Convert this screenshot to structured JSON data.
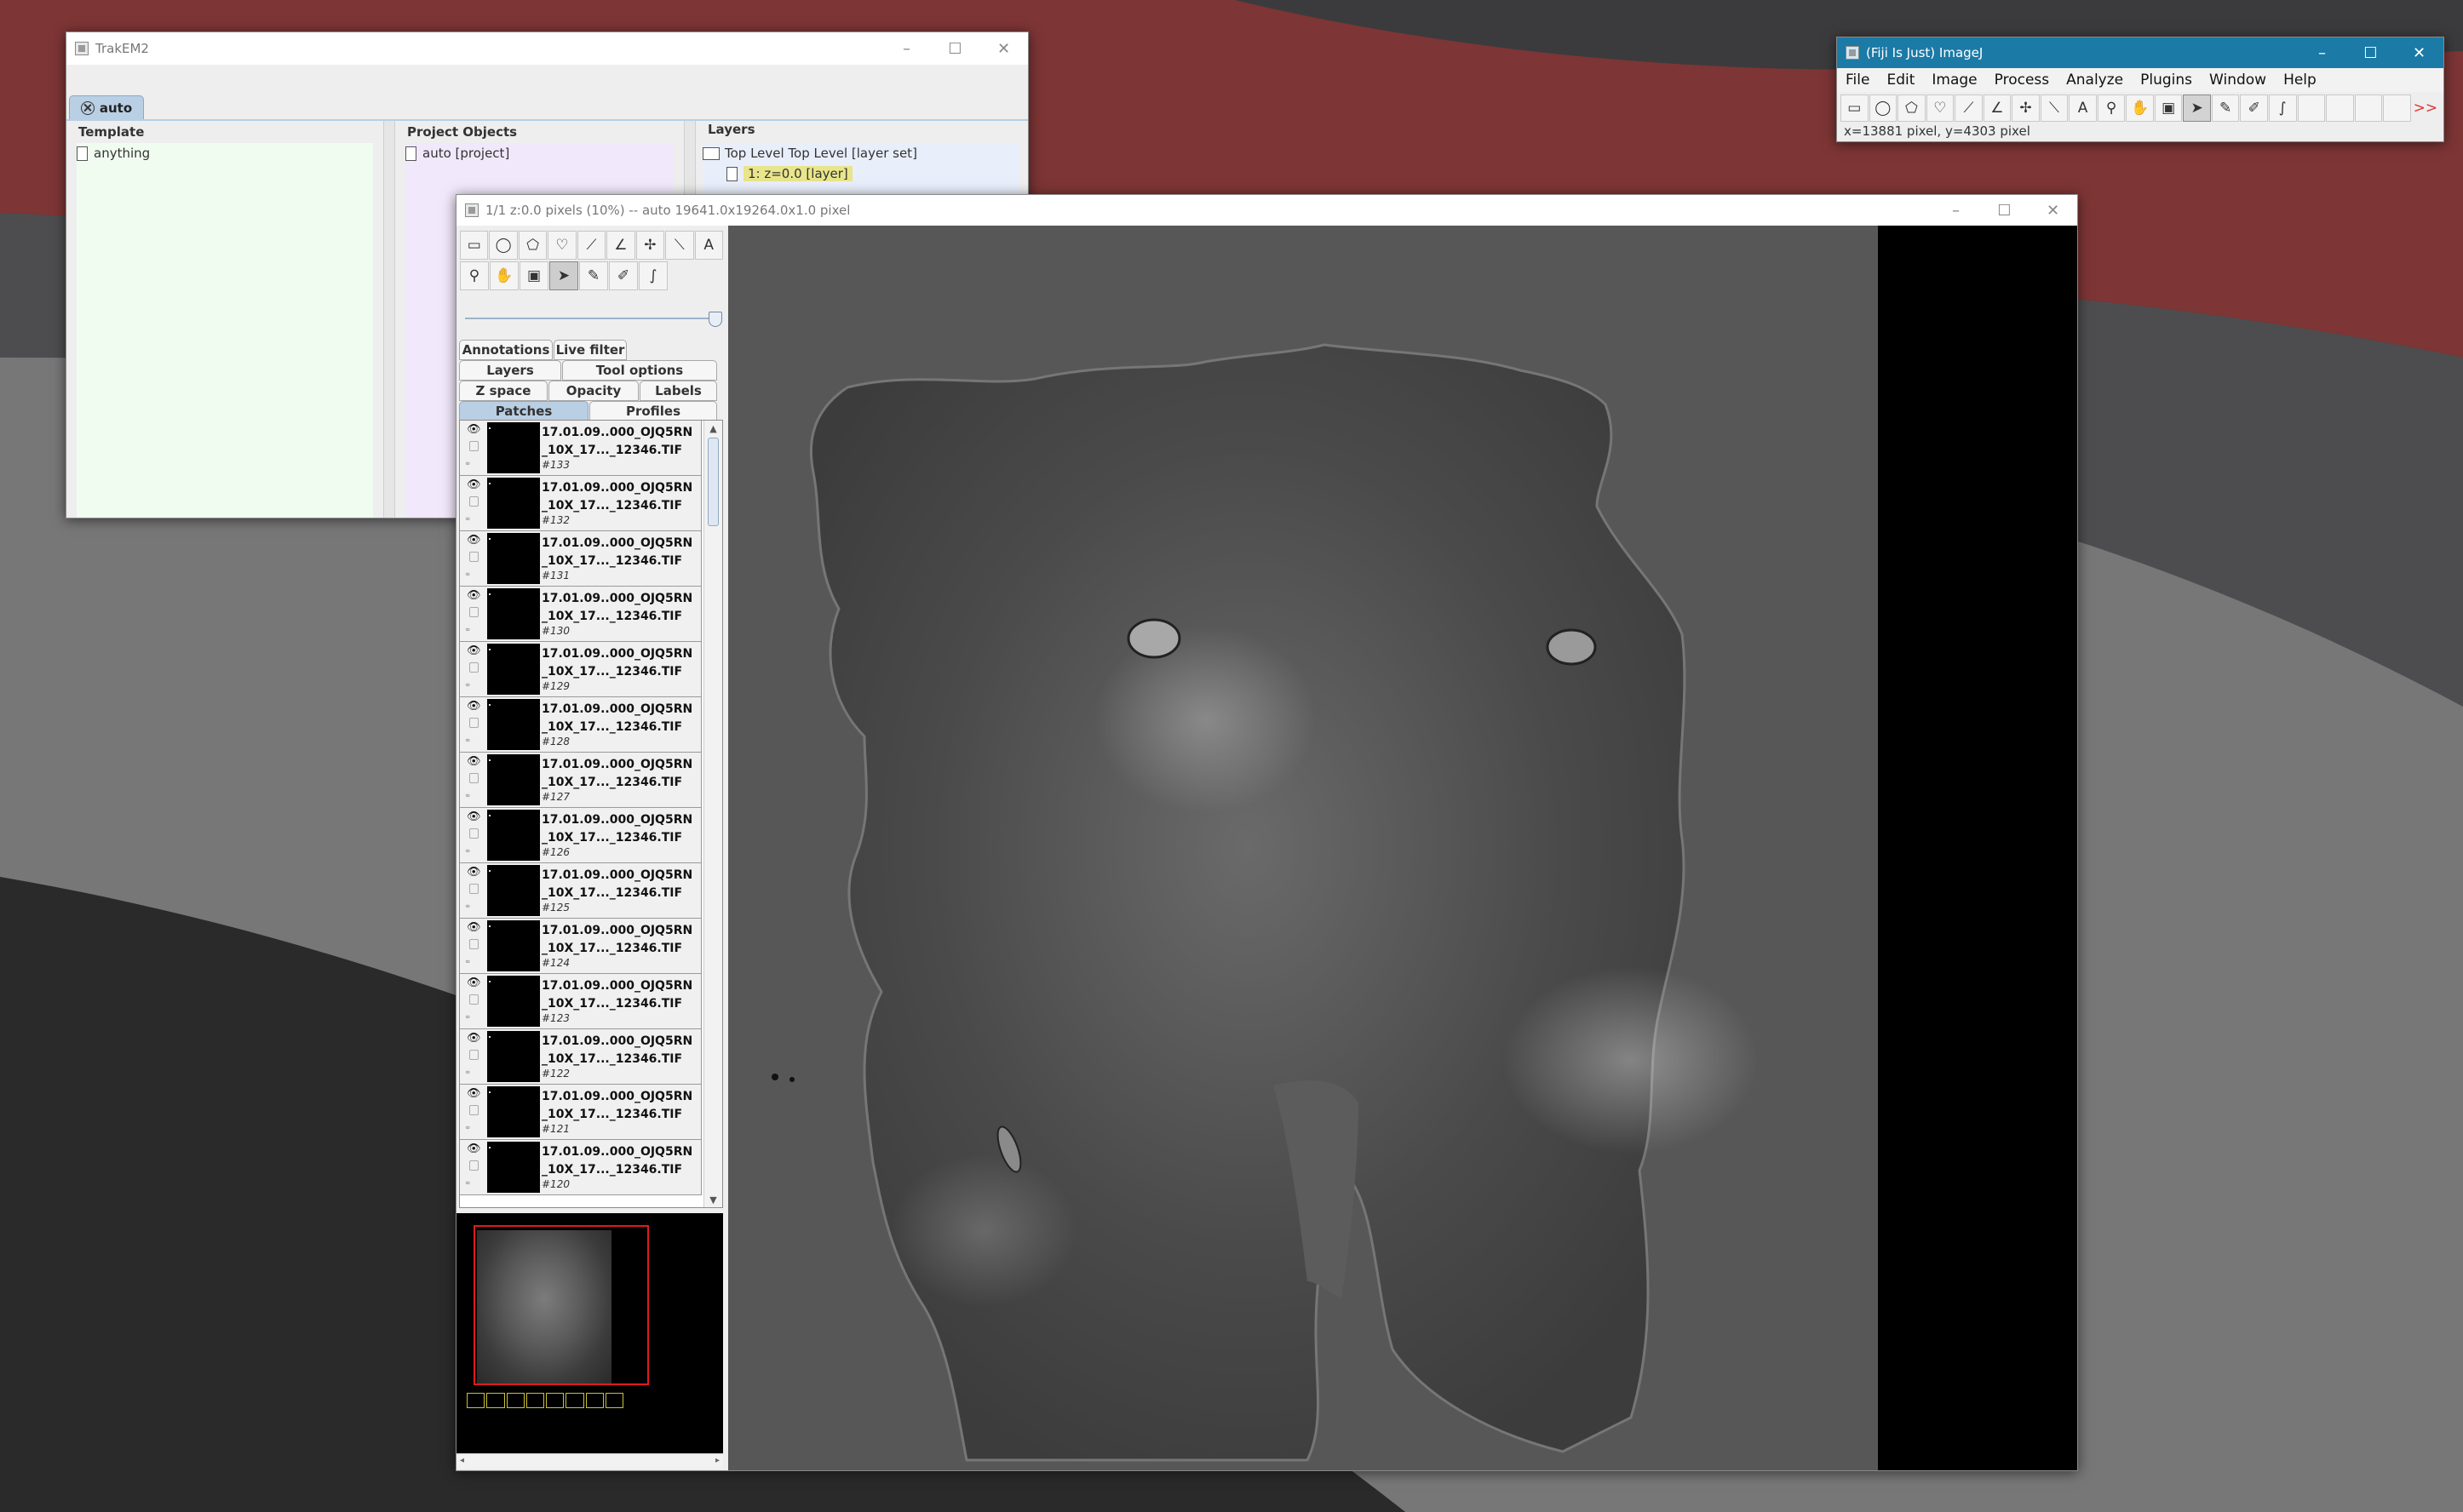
{
  "trakem2": {
    "title": "TrakEM2",
    "tab_label": "auto",
    "template": {
      "header": "Template",
      "node": "anything"
    },
    "project_objects": {
      "header": "Project Objects",
      "node": "auto [project]"
    },
    "layers": {
      "header": "Layers",
      "layer_set": "Top Level Top Level [layer set]",
      "layer": "1: z=0.0 [layer]"
    }
  },
  "fiji": {
    "title": "(Fiji Is Just) ImageJ",
    "menus": [
      "File",
      "Edit",
      "Image",
      "Process",
      "Analyze",
      "Plugins",
      "Window",
      "Help"
    ],
    "status": "x=13881 pixel, y=4303 pixel",
    "more_tools": ">>"
  },
  "display": {
    "title": "1/1  z:0.0 pixels  (10%) -- auto  19641.0x19264.0x1.0 pixel",
    "tabs": {
      "annotations": "Annotations",
      "live_filter": "Live filter",
      "layers": "Layers",
      "tool_options": "Tool options",
      "z_space": "Z space",
      "opacity": "Opacity",
      "labels": "Labels",
      "patches": "Patches",
      "profiles": "Profiles"
    },
    "patch_name": "17.01.09..000_OJQ5RN\n_10X_17..._12346.TIF",
    "patches": [
      {
        "id": "#133"
      },
      {
        "id": "#132"
      },
      {
        "id": "#131"
      },
      {
        "id": "#130"
      },
      {
        "id": "#129"
      },
      {
        "id": "#128"
      },
      {
        "id": "#127"
      },
      {
        "id": "#126"
      },
      {
        "id": "#125"
      },
      {
        "id": "#124"
      },
      {
        "id": "#123"
      },
      {
        "id": "#122"
      },
      {
        "id": "#121"
      },
      {
        "id": "#120"
      }
    ]
  },
  "colors": {
    "fiji_titlebar": "#1b7aa6",
    "selected_tab": "#b9cfe4",
    "template_pane": "#f1fcf0",
    "project_pane": "#f1e8fb",
    "layers_pane": "#e9eefb",
    "navigator_box": "#e01b1b",
    "desktop_red": "#7d3535"
  }
}
